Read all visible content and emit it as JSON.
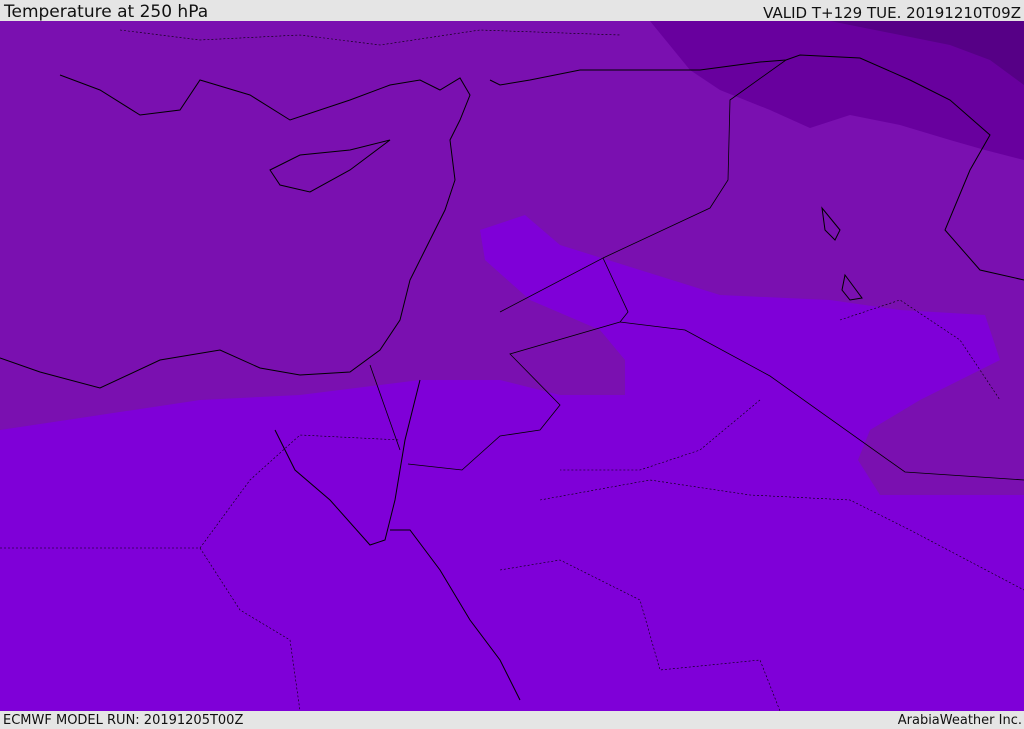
{
  "header": {
    "title": "Temperature at 250 hPa",
    "valid": "VALID T+129 TUE. 20191210T09Z"
  },
  "footer": {
    "model_run": "ECMWF MODEL RUN: 20191205T00Z",
    "credit": "ArabiaWeather Inc."
  },
  "map": {
    "colors": {
      "warmest": "#7f00d8",
      "warm": "#7a10b0",
      "cool": "#68009e",
      "coldest": "#560086",
      "coast": "#000000"
    }
  }
}
